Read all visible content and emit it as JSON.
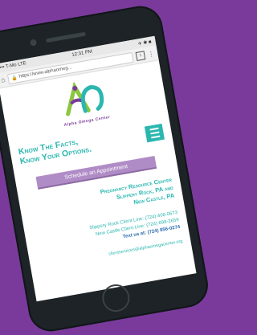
{
  "status_bar": {
    "left": "••• T-Mo LTE",
    "time": "12:31 PM",
    "right": "✈ ✱ ■"
  },
  "browser": {
    "url": "https://www.alphaomeg...",
    "tab_count": "1"
  },
  "logo": {
    "caption": "Alpha Omega Center",
    "colors": {
      "teal": "#2bb7b0",
      "purple": "#7a3a9c",
      "green": "#8cc63f"
    }
  },
  "tagline": {
    "line1": "Know The Facts,",
    "line2": "Know Your Options."
  },
  "appointment_button": "Schedule an Appointment",
  "center": {
    "line1": "Pregnancy Resource Center",
    "line2": "Slippery Rock, PA and",
    "line3": "New Castle, PA"
  },
  "contact": {
    "slippery_rock": "Slippery Rock Client Line: (724) 406-0673",
    "new_castle": "New Castle Client Line: (724) 698-2659",
    "text_us": "Text us at: (724) 856-0274"
  },
  "email": "clientservices@alphaomegacenter.org",
  "colors": {
    "background": "#7a3a9c",
    "accent": "#2bb7b0",
    "button": "#b08cc6"
  }
}
